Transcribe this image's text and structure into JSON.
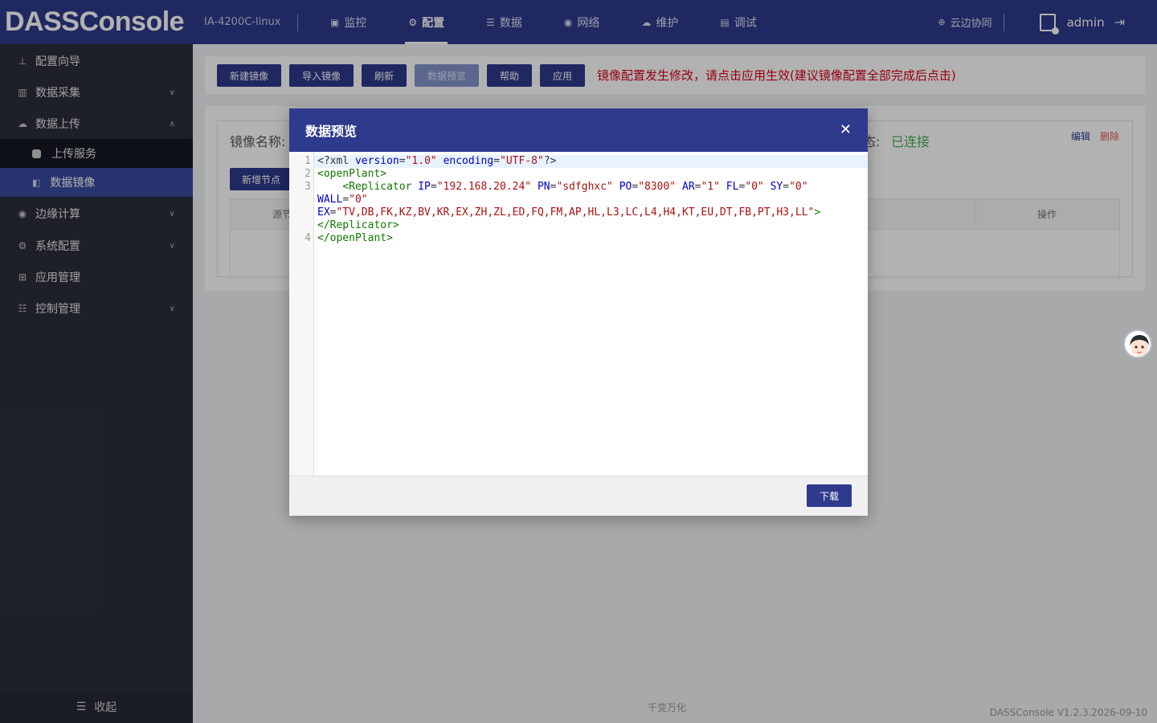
{
  "header": {
    "brand": "DASSConsole",
    "device": "IA-4200C-linux",
    "nav": [
      {
        "label": "监控",
        "icon": "monitor-icon"
      },
      {
        "label": "配置",
        "icon": "gear-icon"
      },
      {
        "label": "数据",
        "icon": "database-icon"
      },
      {
        "label": "网络",
        "icon": "network-icon"
      },
      {
        "label": "维护",
        "icon": "cloud-icon"
      },
      {
        "label": "调试",
        "icon": "debug-icon"
      }
    ],
    "active_nav": "配置",
    "cloud_sync": "云边协同",
    "user": "admin"
  },
  "sidebar": {
    "items": [
      {
        "label": "配置向导",
        "icon": "wizard-icon"
      },
      {
        "label": "数据采集",
        "icon": "collect-icon"
      },
      {
        "label": "数据上传",
        "icon": "upload-icon"
      },
      {
        "label": "边缘计算",
        "icon": "edge-icon"
      },
      {
        "label": "系统配置",
        "icon": "system-icon"
      },
      {
        "label": "应用管理",
        "icon": "apps-icon"
      },
      {
        "label": "控制管理",
        "icon": "control-icon"
      }
    ],
    "subitems": [
      {
        "label": "上传服务"
      },
      {
        "label": "数据镜像"
      }
    ],
    "active_sub": "数据镜像",
    "collapse": "收起"
  },
  "toolbar": {
    "buttons": [
      "新建镜像",
      "导入镜像",
      "刷新",
      "数据预览",
      "帮助",
      "应用"
    ],
    "warning": "镜像配置发生修改，请点击应用生效(建议镜像配置全部完成后点击)"
  },
  "card": {
    "mirror_label": "镜像名称:",
    "status_label": "态:",
    "status_value": "已连接",
    "edit": "编辑",
    "delete": "删除",
    "add_node": "新增节点",
    "columns": [
      "源节",
      "操作"
    ]
  },
  "footer": {
    "center": "千变万化",
    "version": "DASSConsole V1.2.3.2026-09-10"
  },
  "modal": {
    "title": "数据预览",
    "code_lines": [
      "<?xml version=\"1.0\" encoding=\"UTF-8\"?>",
      "<openPlant>",
      "    <Replicator IP=\"192.168.20.24\" PN=\"sdfghxc\" PO=\"8300\" AR=\"1\" FL=\"0\" SY=\"0\" WALL=\"0\" EX=\"TV,DB,FK,KZ,BV,KR,EX,ZH,ZL,ED,FQ,FM,AP,HL,L3,LC,L4,H4,KT,EU,DT,FB,PT,H3,LL\"></Replicator>",
      "</openPlant>"
    ],
    "line_numbers": [
      "1",
      "2",
      "3",
      "4"
    ],
    "download": "下载"
  },
  "colors": {
    "primary": "#2e3a8c",
    "sidebar": "#2b2f3b",
    "warning": "#d9001b",
    "connected": "#4caf50"
  }
}
